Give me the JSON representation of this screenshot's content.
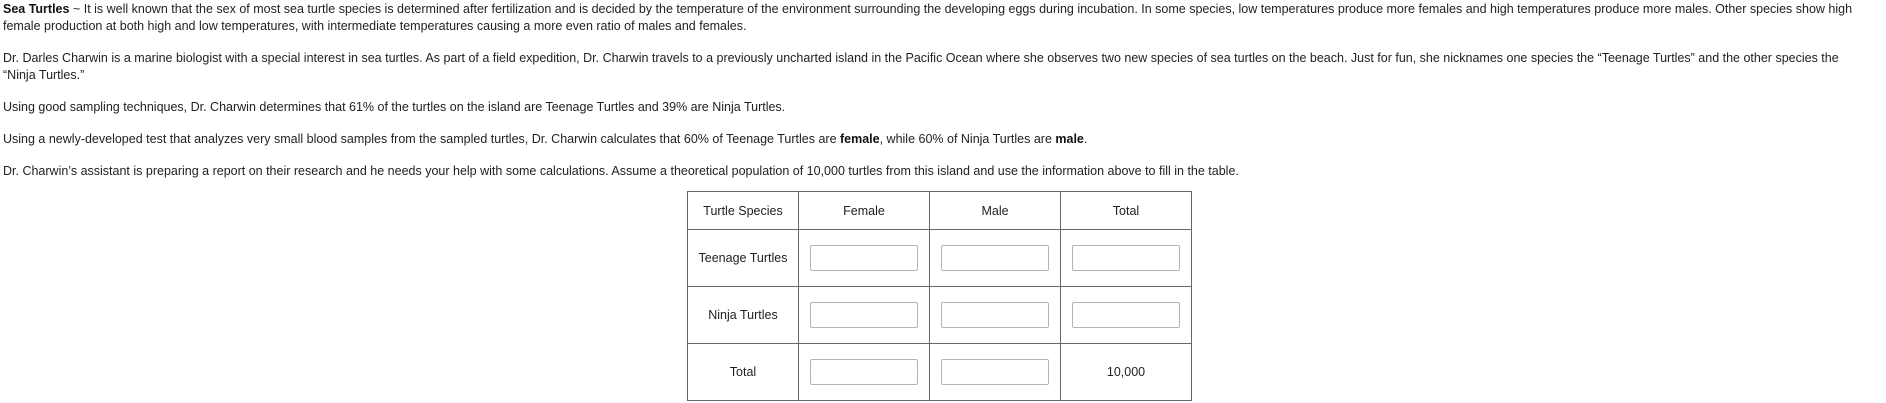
{
  "intro": {
    "title": "Sea Turtles",
    "separator": " ~ ",
    "text": "It is well known that the sex of most sea turtle species is determined after fertilization and is decided by the temperature of the environment surrounding the developing eggs during incubation. In some species, low temperatures produce more females and high temperatures produce more males. Other species show high female production at both high and low temperatures, with intermediate temperatures causing a more even ratio of males and females."
  },
  "para2": "Dr. Darles Charwin is a marine biologist with a special interest in sea turtles. As part of a field expedition, Dr. Charwin travels to a previously uncharted island in the Pacific Ocean where she observes two new species of sea turtles on the beach. Just for fun, she nicknames one species the “Teenage Turtles” and the other species the “Ninja Turtles.”",
  "para3": "Using good sampling techniques, Dr. Charwin determines that 61% of the turtles on the island are Teenage Turtles and 39% are Ninja Turtles.",
  "para4": {
    "before": "Using a newly-developed test that analyzes very small blood samples from the sampled turtles, Dr. Charwin calculates that 60% of Teenage Turtles are ",
    "bold1": "female",
    "middle": ", while 60% of Ninja Turtles are ",
    "bold2": "male",
    "after": "."
  },
  "para5": "Dr. Charwin’s assistant is preparing a report on their research and he needs your help with some calculations. Assume a theoretical population of 10,000 turtles from this island and use the information above to fill in the table.",
  "table": {
    "headers": [
      "Turtle Species",
      "Female",
      "Male",
      "Total"
    ],
    "rows": [
      {
        "label": "Teenage Turtles",
        "female": "",
        "male": "",
        "total": ""
      },
      {
        "label": "Ninja Turtles",
        "female": "",
        "male": "",
        "total": ""
      },
      {
        "label": "Total",
        "female": "",
        "male": "",
        "total_text": "10,000"
      }
    ]
  }
}
